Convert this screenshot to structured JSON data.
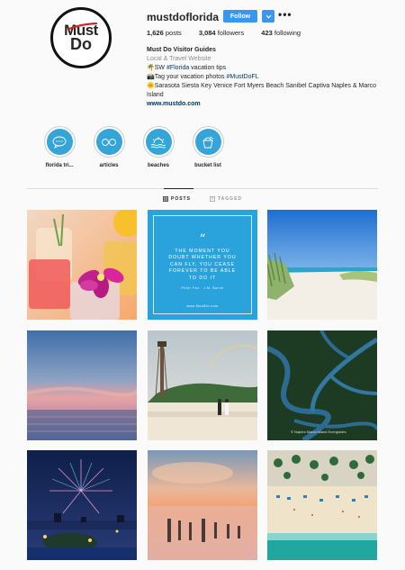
{
  "profile": {
    "username": "mustdoflorida",
    "follow_label": "Follow",
    "more_label": "•••",
    "logo_line1": "Must",
    "logo_line2": "Do",
    "stats": {
      "posts_count": "1,626",
      "posts_label": "posts",
      "followers_count": "3,084",
      "followers_label": "followers",
      "following_count": "423",
      "following_label": "following"
    },
    "bio": {
      "name": "Must Do Visitor Guides",
      "category": "Local & Travel Website",
      "line1_emoji": "🌴",
      "line1_pre": "SW ",
      "line1_tag": "#Florida",
      "line1_post": " vacation tips",
      "line2_emoji": "📸",
      "line2_pre": "Tag your vacation photos ",
      "line2_tag": "#MustDoFL",
      "line3_emoji": "🌞",
      "line3_text": "Sarasota Siesta Key Venice Fort Myers Beach Sanibel Captiva Naples & Marco Island",
      "website": "www.mustdo.com"
    }
  },
  "highlights": [
    {
      "label": "florida tri..."
    },
    {
      "label": "articles"
    },
    {
      "label": "beaches"
    },
    {
      "label": "bucket list"
    }
  ],
  "tabs": {
    "posts": "POSTS",
    "tagged": "TAGGED"
  },
  "posts": {
    "quote": {
      "mark": "“",
      "text": "THE MOMENT YOU DOUBT WHETHER YOU CAN FLY, YOU CEASE FOREVER TO BE ABLE TO DO IT",
      "attribution": "Peter Pan · J.M. Barrie",
      "site": "www.MustDo.com"
    },
    "credit": "© Naples Marco Island Everglades"
  },
  "colors": {
    "accent": "#3897f0",
    "highlight": "#35a5d9",
    "quote_bg": "#2aa3dd",
    "logo_red": "#d6202a"
  }
}
